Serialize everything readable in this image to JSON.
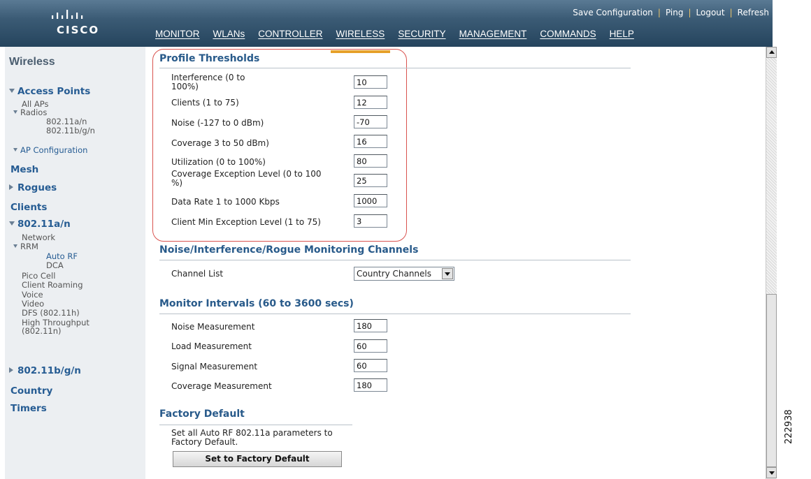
{
  "brand": {
    "logo_text": "CISCO"
  },
  "top_links": {
    "save": "Save Configuration",
    "ping": "Ping",
    "logout": "Logout",
    "refresh": "Refresh"
  },
  "nav": {
    "monitor": "MONITOR",
    "wlans": "WLANs",
    "controller": "CONTROLLER",
    "wireless": "WIRELESS",
    "security": "SECURITY",
    "management": "MANAGEMENT",
    "commands": "COMMANDS",
    "help": "HELP"
  },
  "sidebar": {
    "title": "Wireless",
    "access_points": "Access Points",
    "all_aps": "All APs",
    "radios": "Radios",
    "radio_a": "802.11a/n",
    "radio_bg": "802.11b/g/n",
    "ap_configuration": "AP Configuration",
    "mesh": "Mesh",
    "rogues": "Rogues",
    "clients": "Clients",
    "band_a": "802.11a/n",
    "network": "Network",
    "rrm": "RRM",
    "auto_rf": "Auto RF",
    "dca": "DCA",
    "pico_cell": "Pico Cell",
    "client_roaming": "Client Roaming",
    "voice": "Voice",
    "video": "Video",
    "dfs": "DFS (802.11h)",
    "high_throughput_1": "High Throughput",
    "high_throughput_2": "(802.11n)",
    "band_bg": "802.11b/g/n",
    "country": "Country",
    "timers": "Timers"
  },
  "profile_thresholds": {
    "title": "Profile Thresholds",
    "rows": [
      {
        "label_1": "Interference (0 to",
        "label_2": "100%)",
        "value": "10"
      },
      {
        "label_1": "Clients (1 to 75)",
        "label_2": "",
        "value": "12"
      },
      {
        "label_1": "Noise (-127 to 0 dBm)",
        "label_2": "",
        "value": "-70"
      },
      {
        "label_1": "Coverage 3 to 50 dBm)",
        "label_2": "",
        "value": "16"
      },
      {
        "label_1": "Utilization (0 to 100%)",
        "label_2": "",
        "value": "80"
      },
      {
        "label_1": "Coverage Exception Level (0 to 100",
        "label_2": "%)",
        "value": "25"
      },
      {
        "label_1": "Data Rate 1 to 1000 Kbps",
        "label_2": "",
        "value": "1000"
      },
      {
        "label_1": "Client Min Exception Level (1 to 75)",
        "label_2": "",
        "value": "3"
      }
    ]
  },
  "channels": {
    "title": "Noise/Interference/Rogue Monitoring Channels",
    "label": "Channel List",
    "selected": "Country Channels"
  },
  "monitor_intervals": {
    "title": "Monitor Intervals (60 to 3600 secs)",
    "rows": [
      {
        "label": "Noise Measurement",
        "value": "180"
      },
      {
        "label": "Load Measurement",
        "value": "60"
      },
      {
        "label": "Signal Measurement",
        "value": "60"
      },
      {
        "label": "Coverage Measurement",
        "value": "180"
      }
    ]
  },
  "factory_default": {
    "title": "Factory Default",
    "desc_1": "Set all Auto RF 802.11a parameters to",
    "desc_2": "Factory Default.",
    "button": "Set to Factory Default"
  },
  "figure_id": "222938",
  "colors": {
    "header_bg": "#3b5b75",
    "active_tab": "#e6a02a",
    "section_title": "#285a8a",
    "sidebar_link": "#265c93",
    "highlight": "#d9534f"
  }
}
